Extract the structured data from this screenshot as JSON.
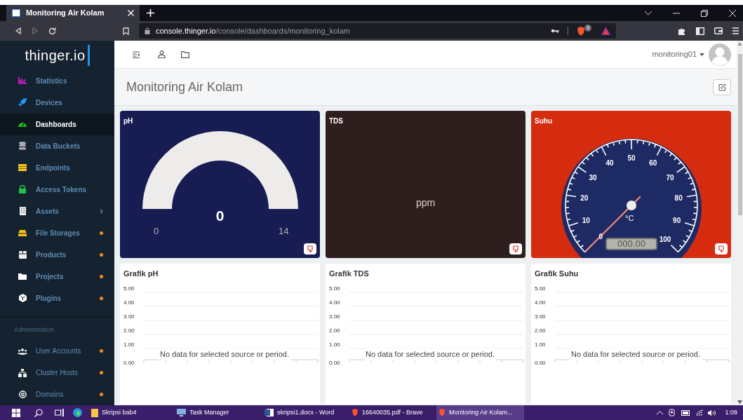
{
  "browser": {
    "tab_title": "Monitoring Air Kolam",
    "url_host": "console.thinger.io",
    "url_path": "/console/dashboards/monitoring_kolam",
    "shield_count": "3"
  },
  "sidebar": {
    "logo": "thinger.io",
    "items": [
      {
        "label": "Statistics",
        "selected": false
      },
      {
        "label": "Devices",
        "selected": false
      },
      {
        "label": "Dashboards",
        "selected": true
      },
      {
        "label": "Data Buckets",
        "selected": false
      },
      {
        "label": "Endpoints",
        "selected": false
      },
      {
        "label": "Access Tokens",
        "selected": false
      },
      {
        "label": "Assets",
        "selected": false,
        "expandable": true
      },
      {
        "label": "File Storages",
        "selected": false,
        "notice": true
      },
      {
        "label": "Products",
        "selected": false,
        "notice": true
      },
      {
        "label": "Projects",
        "selected": false,
        "notice": true
      },
      {
        "label": "Plugins",
        "selected": false,
        "notice": true
      }
    ],
    "section": "Administration",
    "admin_items": [
      {
        "label": "User Accounts",
        "selected": false,
        "notice": true
      },
      {
        "label": "Cluster Hosts",
        "selected": false,
        "notice": true
      },
      {
        "label": "Domains",
        "selected": false,
        "notice": true
      }
    ]
  },
  "header": {
    "user": "monitoring01"
  },
  "page_title": "Monitoring Air Kolam",
  "widgets": [
    {
      "kind": "donut",
      "title": "pH",
      "color": "#171c52",
      "value": "0",
      "min": "0",
      "max": "14"
    },
    {
      "kind": "text",
      "title": "TDS",
      "color": "#2f1e1e",
      "value": "ppm"
    },
    {
      "kind": "speedometer",
      "title": "Suhu",
      "color": "#d52b0f",
      "unit": "°C",
      "display": "000.00",
      "scale": [
        "0",
        "10",
        "20",
        "30",
        "40",
        "50",
        "60",
        "70",
        "80",
        "90",
        "100"
      ]
    }
  ],
  "charts": [
    {
      "title": "Grafik pH",
      "message": "No data for selected source or period.",
      "y_labels": [
        "5.00",
        "4.00",
        "3.00",
        "2.00",
        "1.00",
        "0.00"
      ]
    },
    {
      "title": "Grafik TDS",
      "message": "No data for selected source or period.",
      "y_labels": [
        "5.00",
        "4.00",
        "3.00",
        "2.00",
        "1.00",
        "0.00"
      ]
    },
    {
      "title": "Grafik Suhu",
      "message": "No data for selected source or period.",
      "y_labels": [
        "5.00",
        "4.00",
        "3.00",
        "2.00",
        "1.00",
        "0.00"
      ]
    }
  ],
  "taskbar": {
    "items": [
      {
        "label": "Skripsi bab4",
        "selected": false
      },
      {
        "label": "Task Manager",
        "selected": false
      },
      {
        "label": "skripsi1.docx - Word",
        "selected": false
      },
      {
        "label": "16640035.pdf - Brave",
        "selected": false
      },
      {
        "label": "Monitoring Air Kolam...",
        "selected": true
      }
    ],
    "clock": "1:09"
  }
}
